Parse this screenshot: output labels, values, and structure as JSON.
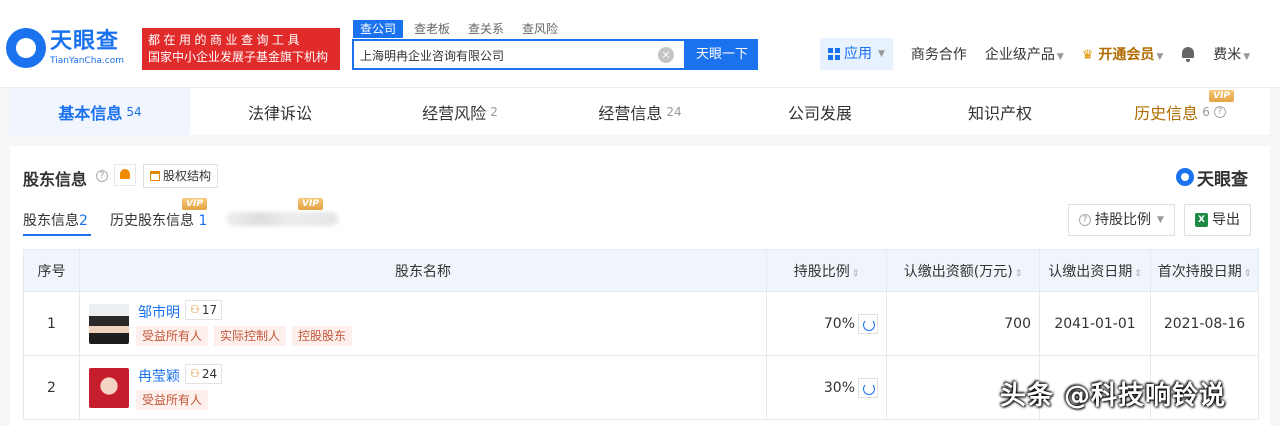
{
  "brand": {
    "name": "天眼查",
    "url": "TianYanCha.com",
    "slogan_line1": "都在用的商业查询工具",
    "slogan_line2": "国家中小企业发展子基金旗下机构"
  },
  "search": {
    "tabs": [
      "查公司",
      "查老板",
      "查关系",
      "查风险"
    ],
    "value": "上海明冉企业咨询有限公司",
    "button_label": "天眼一下"
  },
  "nav": {
    "app": "应用",
    "business": "商务合作",
    "enterprise": "企业级产品",
    "vip": "开通会员",
    "user": "费米"
  },
  "main_tabs": [
    {
      "label": "基本信息",
      "count": "54"
    },
    {
      "label": "法律诉讼",
      "count": ""
    },
    {
      "label": "经营风险",
      "count": "2"
    },
    {
      "label": "经营信息",
      "count": "24"
    },
    {
      "label": "公司发展",
      "count": ""
    },
    {
      "label": "知识产权",
      "count": ""
    },
    {
      "label": "历史信息",
      "count": "6"
    }
  ],
  "vip_label": "VIP",
  "section": {
    "title": "股东信息",
    "structure_button": "股权结构",
    "brand_mark": "天眼查",
    "subtabs": [
      {
        "label": "股东信息",
        "count": "2"
      },
      {
        "label": "历史股东信息",
        "count": "1"
      }
    ],
    "ratio_button": "持股比例",
    "export_button": "导出",
    "excel_glyph": "X"
  },
  "table": {
    "headers": [
      "序号",
      "股东名称",
      "持股比例",
      "认缴出资额(万元)",
      "认缴出资日期",
      "首次持股日期"
    ],
    "rows": [
      {
        "idx": "1",
        "name": "邹市明",
        "relations": "17",
        "tags": [
          "受益所有人",
          "实际控制人",
          "控股股东"
        ],
        "ratio": "70%",
        "amount": "700",
        "date": "2041-01-01",
        "first_date": "2021-08-16"
      },
      {
        "idx": "2",
        "name": "冉莹颖",
        "relations": "24",
        "tags": [
          "受益所有人"
        ],
        "ratio": "30%",
        "amount": "",
        "date": "",
        "first_date": ""
      }
    ]
  },
  "watermark": "头条 @科技响铃说"
}
